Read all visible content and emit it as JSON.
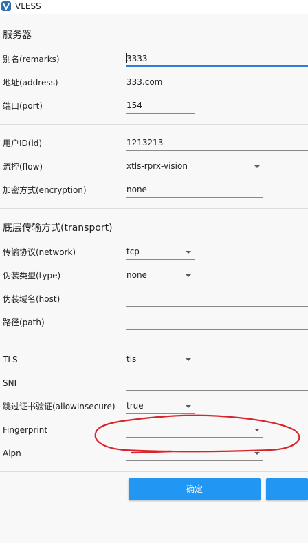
{
  "window": {
    "title": "VLESS",
    "app_icon": "v2rayn-v-logo-icon",
    "app_icon_color": "#2f6fb4"
  },
  "server": {
    "section_title": "服务器",
    "remarks": {
      "label": "别名(remarks)",
      "value": "3333"
    },
    "address": {
      "label": "地址(address)",
      "value": "333.com"
    },
    "port": {
      "label": "端口(port)",
      "value": "154"
    }
  },
  "user": {
    "id": {
      "label": "用户ID(id)",
      "value": "1213213"
    },
    "flow": {
      "label": "流控(flow)",
      "value": "xtls-rprx-vision"
    },
    "encryption": {
      "label": "加密方式(encryption)",
      "value": "none"
    }
  },
  "transport": {
    "section_title": "底层传输方式(transport)",
    "network": {
      "label": "传输协议(network)",
      "value": "tcp"
    },
    "type": {
      "label": "伪装类型(type)",
      "value": "none"
    },
    "host": {
      "label": "伪装域名(host)",
      "value": ""
    },
    "path": {
      "label": "路径(path)",
      "value": ""
    }
  },
  "tls": {
    "security": {
      "label": "TLS",
      "value": "tls"
    },
    "sni": {
      "label": "SNI",
      "value": ""
    },
    "allow_insecure": {
      "label": "跳过证书验证(allowInsecure)",
      "value": "true"
    },
    "fingerprint": {
      "label": "Fingerprint",
      "value": ""
    },
    "alpn": {
      "label": "Alpn",
      "value": ""
    }
  },
  "buttons": {
    "ok_label": "确定",
    "cancel_label": ""
  },
  "colors": {
    "accent": "#2196f3",
    "focus_underline": "#2b7fd6",
    "annotation": "#d8242a"
  }
}
